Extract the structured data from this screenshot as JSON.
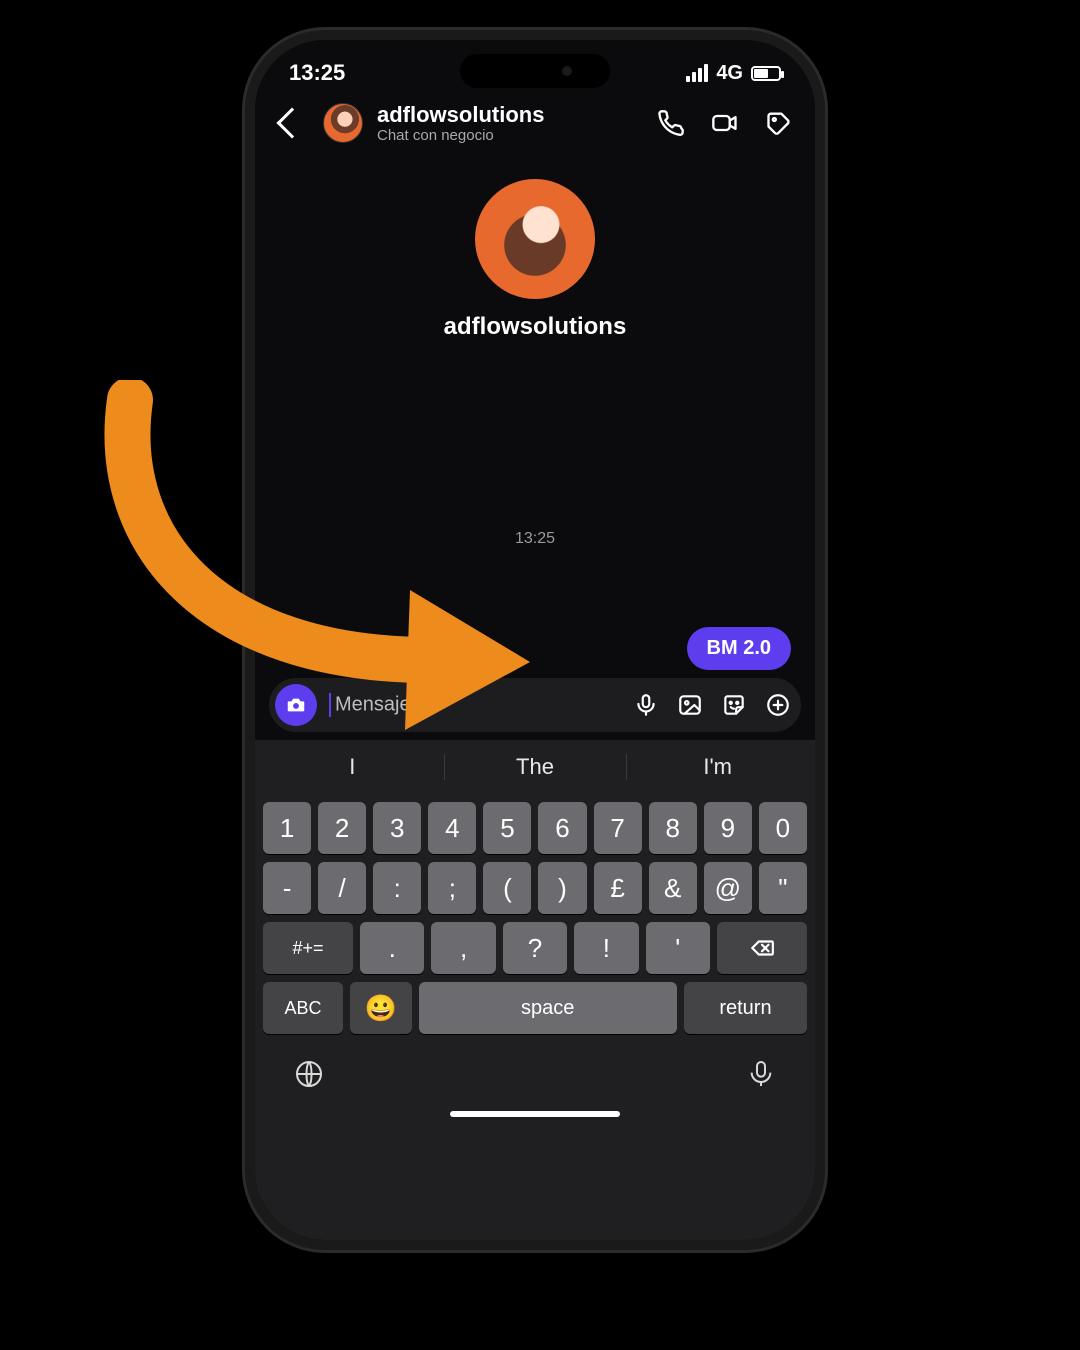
{
  "status": {
    "time": "13:25",
    "network": "4G"
  },
  "header": {
    "username": "adflowsolutions",
    "subtitle": "Chat con negocio"
  },
  "profile": {
    "display_name": "adflowsolutions"
  },
  "chat": {
    "timestamp": "13:25",
    "last_sent_message": "BM 2.0"
  },
  "composer": {
    "placeholder": "Mensaje..."
  },
  "keyboard": {
    "suggestions": [
      "I",
      "The",
      "I'm"
    ],
    "row1": [
      "1",
      "2",
      "3",
      "4",
      "5",
      "6",
      "7",
      "8",
      "9",
      "0"
    ],
    "row2": [
      "-",
      "/",
      ":",
      ";",
      "(",
      ")",
      "£",
      "&",
      "@",
      "\""
    ],
    "row3_shift": "#+=",
    "row3": [
      ".",
      ",",
      "?",
      "!",
      "'"
    ],
    "row3_backspace": "⌫",
    "bottom": {
      "abc": "ABC",
      "space": "space",
      "return": "return"
    }
  },
  "colors": {
    "accent": "#5e3dee",
    "annotation": "#ed8b1c"
  }
}
